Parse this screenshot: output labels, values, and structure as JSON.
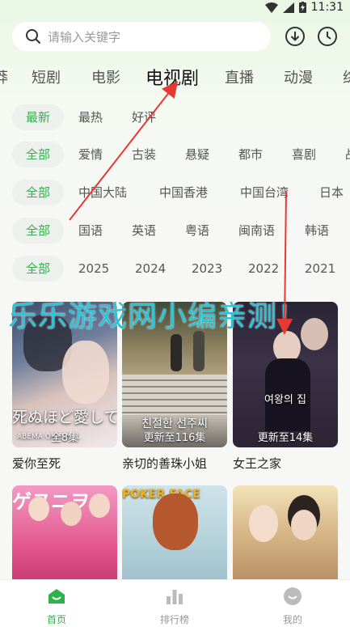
{
  "status": {
    "time": "11:31"
  },
  "search": {
    "placeholder": "请输入关键字"
  },
  "top_icons": {
    "download": "download-icon",
    "history": "clock-icon"
  },
  "category_tabs": [
    {
      "label": "莽"
    },
    {
      "label": "短剧"
    },
    {
      "label": "电影"
    },
    {
      "label": "电视剧",
      "active": true
    },
    {
      "label": "直播"
    },
    {
      "label": "动漫"
    },
    {
      "label": "综"
    }
  ],
  "filters": {
    "sort": [
      "最新",
      "最热",
      "好评"
    ],
    "genre": [
      "全部",
      "爱情",
      "古装",
      "悬疑",
      "都市",
      "喜剧",
      "战"
    ],
    "region": [
      "全部",
      "中国大陆",
      "中国香港",
      "中国台湾",
      "日本"
    ],
    "language": [
      "全部",
      "国语",
      "英语",
      "粤语",
      "闽南语",
      "韩语"
    ],
    "year": [
      "全部",
      "2025",
      "2024",
      "2023",
      "2022",
      "2021"
    ]
  },
  "watermark": "乐乐游戏网小编亲测！",
  "cards": [
    {
      "title": "爱你至死",
      "episodes": "全8集",
      "poster_text": "死ぬほど愛して",
      "poster_sub": "ABEMA ORIGINAL"
    },
    {
      "title": "亲切的善珠小姐",
      "episodes": "更新至116集",
      "poster_text": "친절한 선주씨"
    },
    {
      "title": "女王之家",
      "episodes": "更新至14集",
      "poster_text": "여왕의 집"
    }
  ],
  "row2_posters": [
    {
      "poster_text": "ゲヌニヲ"
    },
    {
      "poster_text": "POKER FACE"
    },
    {
      "poster_text": ""
    }
  ],
  "bottom_nav": [
    {
      "label": "首页",
      "active": true
    },
    {
      "label": "排行榜"
    },
    {
      "label": "我的"
    }
  ],
  "colors": {
    "accent": "#2fb24a",
    "watermark": "#26c6d8",
    "arrow": "#e53935"
  }
}
